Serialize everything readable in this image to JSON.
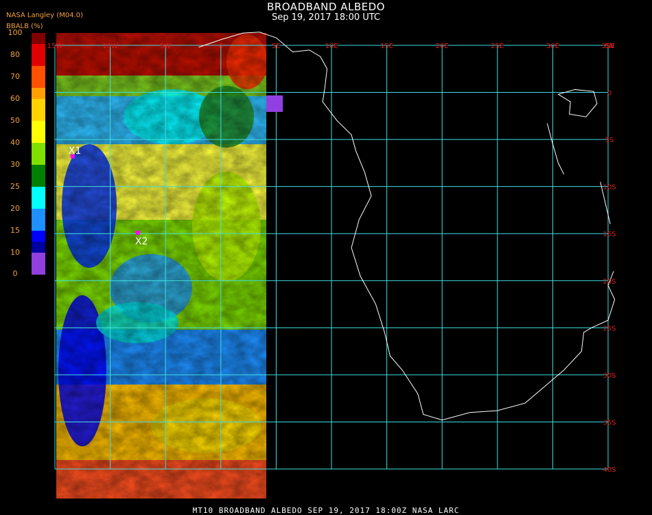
{
  "header": {
    "title": "BROADBAND ALBEDO",
    "subtitle": "Sep 19, 2017 18:00 UTC",
    "producer": "NASA Langley (M04.0)"
  },
  "colorbar": {
    "label": "BBALB (%)",
    "ticks": [
      "100",
      "80",
      "70",
      "60",
      "50",
      "40",
      "30",
      "25",
      "20",
      "15",
      "10",
      "0"
    ],
    "bins": [
      {
        "from": 90,
        "to": 100,
        "color": "#800000"
      },
      {
        "from": 80,
        "to": 90,
        "color": "#e00000"
      },
      {
        "from": 70,
        "to": 80,
        "color": "#ff5000"
      },
      {
        "from": 60,
        "to": 70,
        "color": "#ffa000"
      },
      {
        "from": 50,
        "to": 60,
        "color": "#ffd200"
      },
      {
        "from": 40,
        "to": 50,
        "color": "#ffff00"
      },
      {
        "from": 35,
        "to": 40,
        "color": "#80e000"
      },
      {
        "from": 30,
        "to": 35,
        "color": "#008000"
      },
      {
        "from": 25,
        "to": 30,
        "color": "#00ffff"
      },
      {
        "from": 20,
        "to": 25,
        "color": "#1e90ff"
      },
      {
        "from": 15,
        "to": 20,
        "color": "#0000ff"
      },
      {
        "from": 10,
        "to": 15,
        "color": "#0000a0"
      },
      {
        "from": 0,
        "to": 10,
        "color": "#9040e0"
      }
    ]
  },
  "map": {
    "lon_labels": [
      "15W",
      "10W",
      "5W",
      "0",
      "5E",
      "10E",
      "15E",
      "20E",
      "25E",
      "30E",
      "35E"
    ],
    "lat_labels": [
      "5N",
      "0",
      "5S",
      "10S",
      "15S",
      "20S",
      "25S",
      "30S",
      "35S",
      "40S"
    ],
    "lon_range": [
      -15,
      35
    ],
    "lat_range": [
      -40,
      5
    ],
    "grid_color": "#40e0e0",
    "label_color": "#e02020",
    "coast_color": "#ffffff",
    "markers": [
      {
        "label": "X1",
        "lon": -13.4,
        "lat": -6.8,
        "color": "#ff00ff"
      },
      {
        "label": "X2",
        "lon": -7.5,
        "lat": -14.9,
        "color": "#ff00ff"
      }
    ]
  },
  "footer": {
    "text": "MT10   BROADBAND ALBEDO   SEP 19, 2017 18:00Z   NASA LARC"
  }
}
